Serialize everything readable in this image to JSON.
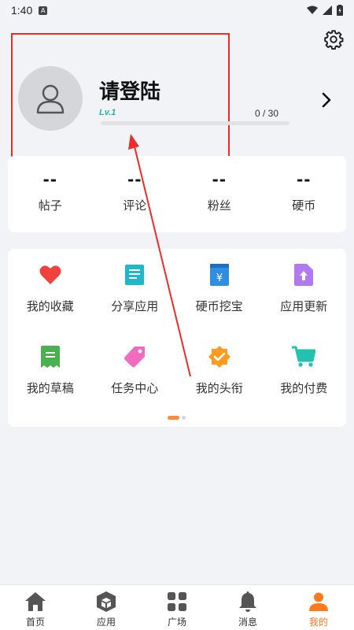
{
  "status_bar": {
    "time": "1:40",
    "notif_letter": "A"
  },
  "profile": {
    "title": "请登陆",
    "level": "Lv.1",
    "progress_text": "0 / 30",
    "progress_fraction": 0.0
  },
  "stats": [
    {
      "value": "--",
      "label": "帖子"
    },
    {
      "value": "--",
      "label": "评论"
    },
    {
      "value": "--",
      "label": "粉丝"
    },
    {
      "value": "--",
      "label": "硬币"
    }
  ],
  "menu": [
    {
      "label": "我的收藏",
      "icon": "heart-icon",
      "color": "#f0413c"
    },
    {
      "label": "分享应用",
      "icon": "document-icon",
      "color": "#1fb8c9"
    },
    {
      "label": "硬币挖宝",
      "icon": "coin-bag-icon",
      "color": "#2f8de4"
    },
    {
      "label": "应用更新",
      "icon": "upload-file-icon",
      "color": "#b278f0"
    },
    {
      "label": "我的草稿",
      "icon": "receipt-icon",
      "color": "#4caf50"
    },
    {
      "label": "任务中心",
      "icon": "tag-icon",
      "color": "#f06cc0"
    },
    {
      "label": "我的头衔",
      "icon": "badge-icon",
      "color": "#ff9a1f"
    },
    {
      "label": "我的付费",
      "icon": "cart-icon",
      "color": "#22c1b0"
    }
  ],
  "bottom_nav": [
    {
      "label": "首页",
      "icon": "home-icon",
      "active": false
    },
    {
      "label": "应用",
      "icon": "box-icon",
      "active": false
    },
    {
      "label": "广场",
      "icon": "grid-icon",
      "active": false
    },
    {
      "label": "消息",
      "icon": "bell-icon",
      "active": false
    },
    {
      "label": "我的",
      "icon": "person-icon",
      "active": true
    }
  ],
  "colors": {
    "accent": "#ff7a1f",
    "teal": "#26b4a4",
    "annotation": "#ee2b2b"
  }
}
